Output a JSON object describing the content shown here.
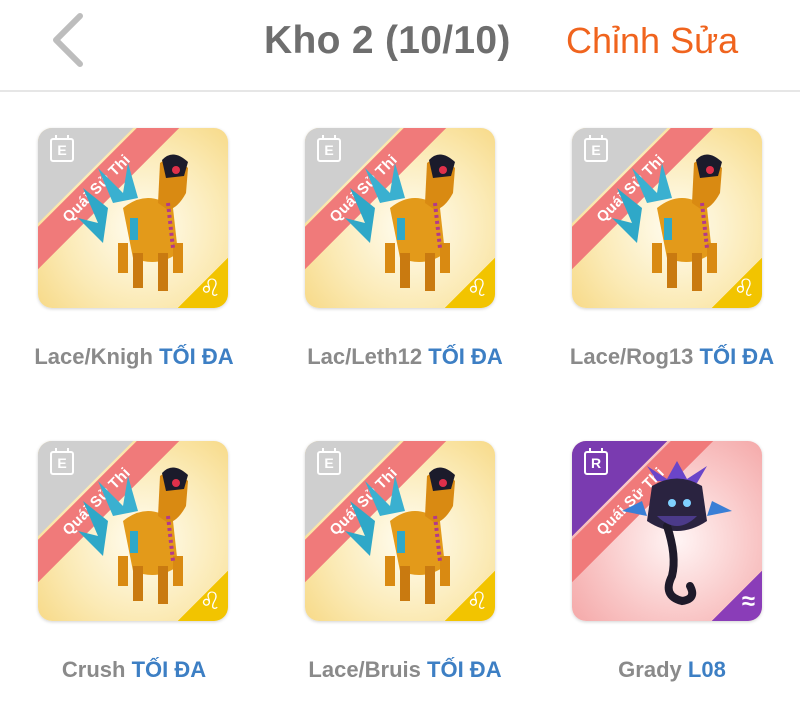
{
  "header": {
    "title": "Kho 2 (10/10)",
    "edit_label": "Chỉnh Sửa",
    "back_icon": "chevron-left-icon"
  },
  "colors": {
    "accent": "#f0641e",
    "title": "#6e6e6e",
    "label": "#8a8a8a",
    "level": "#3d7fc4",
    "ribbon": "#f07a7a",
    "epic_badge": "#f2c400",
    "rare_badge": "#8a3db8"
  },
  "monsters": [
    {
      "name": "Lace/Knigh",
      "level": "TỐI ĐA",
      "ribbon": "Quái Sử Thi",
      "grade": "E",
      "element_icon": "leo-icon",
      "element_glyph": "♌",
      "art": "winged-horse-icon"
    },
    {
      "name": "Lac/Leth12",
      "level": "TỐI ĐA",
      "ribbon": "Quái Sử Thi",
      "grade": "E",
      "element_icon": "leo-icon",
      "element_glyph": "♌",
      "art": "winged-horse-icon"
    },
    {
      "name": "Lace/Rog13",
      "level": "TỐI ĐA",
      "ribbon": "Quái Sử Thi",
      "grade": "E",
      "element_icon": "leo-icon",
      "element_glyph": "♌",
      "art": "winged-horse-icon"
    },
    {
      "name": "Crush",
      "level": "TỐI ĐA",
      "ribbon": "Quái Sử Thi",
      "grade": "E",
      "element_icon": "leo-icon",
      "element_glyph": "♌",
      "art": "winged-horse-icon"
    },
    {
      "name": "Lace/Bruis",
      "level": "TỐI ĐA",
      "ribbon": "Quái Sử Thi",
      "grade": "E",
      "element_icon": "leo-icon",
      "element_glyph": "♌",
      "art": "winged-horse-icon"
    },
    {
      "name": "Grady",
      "level": "L08",
      "ribbon": "Quái Sử Thi",
      "grade": "R",
      "element_icon": "water-wave-icon",
      "element_glyph": "≈",
      "art": "dark-dragon-icon"
    }
  ]
}
